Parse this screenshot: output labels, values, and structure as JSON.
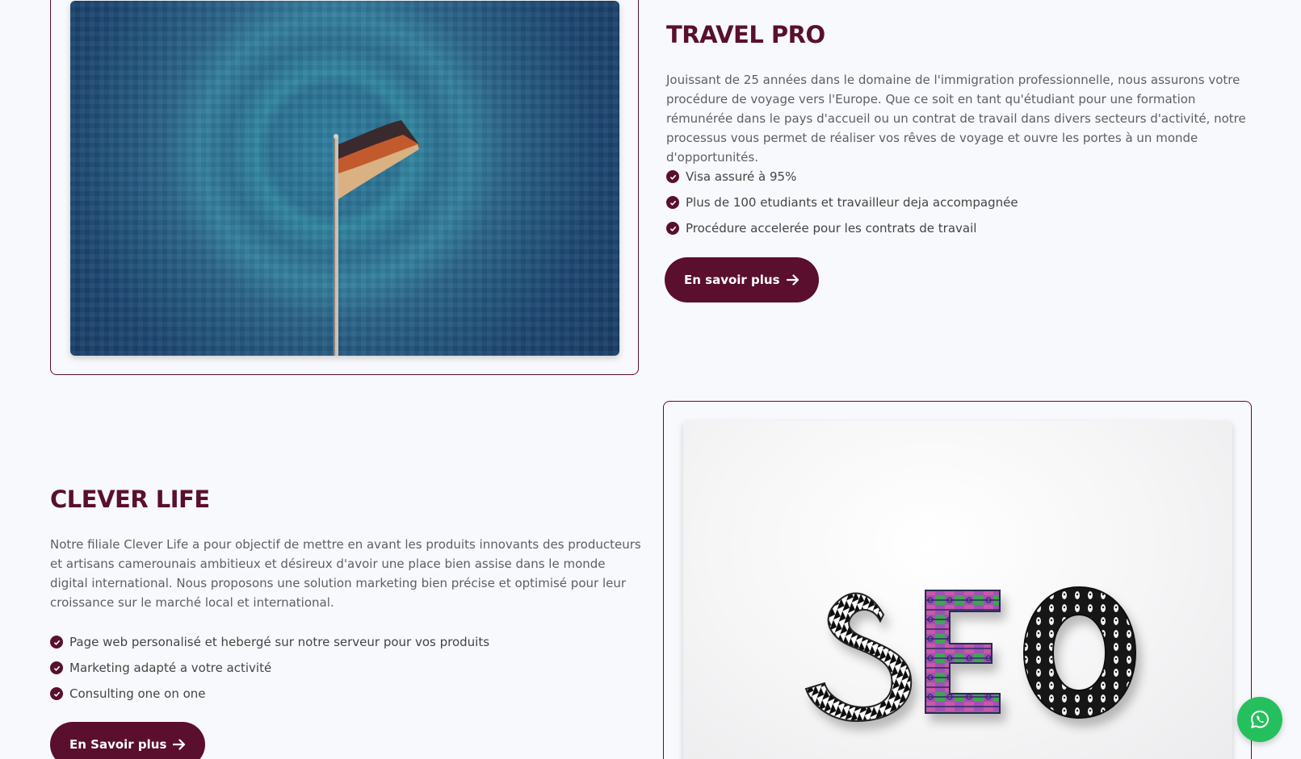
{
  "travel_pro": {
    "title": "TRAVEL PRO",
    "description": "Jouissant de 25 années dans le domaine de l'immigration professionnelle, nous assurons votre procédure de voyage vers l'Europe. Que ce soit en tant qu'étudiant pour une formation rémunérée dans le pays d'accueil ou un contrat de travail dans divers secteurs d'activité, notre processus vous permet de réaliser vos rêves de voyage et ouvre les portes à un monde d'opportunités.",
    "features": [
      "Visa assuré à 95%",
      "Plus de 100 etudiants et travailleur deja accompagnée",
      "Procédure accelerée pour les contrats de travail"
    ],
    "button_label": "En savoir plus",
    "image_icon": "german-flag-photo"
  },
  "clever_life": {
    "title": "CLEVER LIFE",
    "description": "Notre filiale Clever Life a pour objectif de mettre en avant les produits innovants des producteurs et artisans camerounais ambitieux et désireux d'avoir une place bien assise dans le monde digital international. Nous proposons une solution marketing bien précise et optimisé pour leur croissance sur le marché local et international.",
    "features": [
      "Page web personalisé et hebergé sur notre serveur pour vos produits",
      "Marketing adapté a votre activité",
      "Consulting one on one"
    ],
    "button_label": "En Savoir plus",
    "image_icon": "seo-letters-photo"
  },
  "colors": {
    "brand": "#5a0f2e",
    "whatsapp": "#25c05d",
    "background": "#f8f9fc"
  },
  "whatsapp_icon": "whatsapp-icon"
}
